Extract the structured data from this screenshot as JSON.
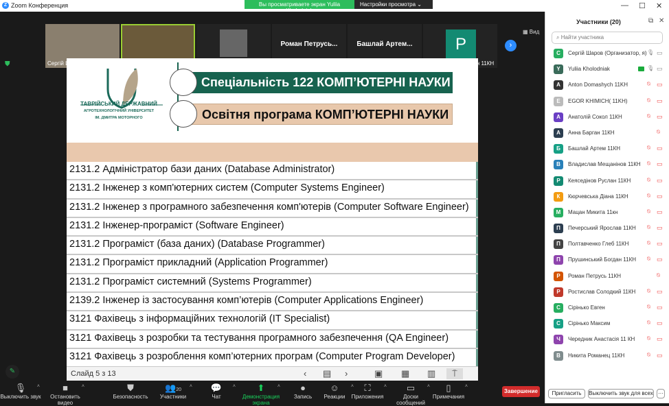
{
  "window": {
    "title": "Zoom Конференция",
    "banner": "Вы просматриваете экран Yuliia Kholodniak",
    "view_settings": "Настройки просмотра",
    "view_label": "Вид"
  },
  "videos": [
    {
      "name": "Сергій Шаров",
      "muted": false,
      "big": ""
    },
    {
      "name": "Yuliia Kholodniak",
      "muted": false,
      "big": ""
    },
    {
      "name": "Anton Domashych 11KH",
      "muted": true,
      "big": ""
    },
    {
      "name": "Роман Петрусь 11КН",
      "muted": true,
      "big": "Роман  Петрусь..."
    },
    {
      "name": "Башлай Артем 11КН",
      "muted": true,
      "big": "Башлай  Артем..."
    },
    {
      "name": "Кеяседінов Руслан 11КН",
      "muted": true,
      "big": "P"
    }
  ],
  "slide": {
    "university": [
      "ТАВРІЙСЬКИЙ ДЕРЖАВНИЙ",
      "АГРОТЕХНОЛОГІЧНИЙ УНІВЕРСИТЕТ",
      "ІМ. ДМИТРА МОТОРНОГО"
    ],
    "specialty": "Спеціальність 122 КОМП’ЮТЕРНІ НАУКИ",
    "program": "Освітня програма КОМП’ЮТЕРНІ НАУКИ",
    "rows": [
      "2131.2 Адміністратор бази даних (Database Administrator)",
      "2131.2 Інженер з комп'ютерних систем (Computer Systems Engineer)",
      "2131.2 Інженер з програмного забезпечення комп'ютерів (Computer Software Engineer)",
      "2131.2 Інженер-програміст (Software Engineer)",
      "2131.2 Програміст (база даних) (Database Programmer)",
      "2131.2 Програміст прикладний (Application Programmer)",
      "2131.2 Програміст системний (Systems Programmer)",
      "2139.2 Інженер із застосування комп’ютерів (Computer Applications Engineer)",
      "3121 Фахівець з інформаційних технологій (IT Specialist)",
      "3121 Фахівець з розробки та тестування програмного забезпечення (QA Engineer)",
      "3121 Фахівець з розроблення комп’ютерних програм (Computer Program Developer)"
    ],
    "counter": "Слайд 5 з 13"
  },
  "toolbar": {
    "items": [
      {
        "label": "Выключить звук",
        "icon": "microphone-icon"
      },
      {
        "label": "Остановить видео",
        "icon": "video-camera-icon"
      },
      {
        "label": "Безопасность",
        "icon": "shield-icon"
      },
      {
        "label": "Участники",
        "icon": "participants-icon",
        "badge": "20"
      },
      {
        "label": "Чат",
        "icon": "chat-icon"
      },
      {
        "label": "Демонстрация экрана",
        "icon": "share-screen-icon"
      },
      {
        "label": "Запись",
        "icon": "record-icon"
      },
      {
        "label": "Реакции",
        "icon": "reactions-icon"
      },
      {
        "label": "Приложения",
        "icon": "apps-icon"
      },
      {
        "label": "Доски сообщений",
        "icon": "whiteboard-icon"
      },
      {
        "label": "Примечания",
        "icon": "notes-icon"
      }
    ],
    "end": "Завершение"
  },
  "panel": {
    "title": "Участники (20)",
    "search_placeholder": "Найти участника",
    "invite": "Пригласить",
    "mute_all": "Выключить звук для всех",
    "more": "···",
    "participants": [
      {
        "name": "Сергій Шаров (Организатор, я)",
        "initial": "С",
        "color": "#27ae60",
        "mic": "on",
        "cam": "off-gray"
      },
      {
        "name": "Yuliia Kholodniak",
        "initial": "Y",
        "color": "#3a6b5a",
        "mic": "on",
        "cam": "off-gray",
        "sharing": true
      },
      {
        "name": "Anton Domashych 11KH",
        "initial": "A",
        "color": "#333333",
        "mic": "muted",
        "cam": "off"
      },
      {
        "name": "EGOR KHIMICH( 11KH)",
        "initial": "E",
        "color": "#bbbbbb",
        "mic": "muted",
        "cam": "off"
      },
      {
        "name": "Анатолій Сокол 11КН",
        "initial": "А",
        "color": "#6a3fc4",
        "mic": "muted",
        "cam": "off"
      },
      {
        "name": "Анна Барган 11КН",
        "initial": "А",
        "color": "#2c3e50",
        "mic": "muted",
        "cam": "none"
      },
      {
        "name": "Башлай Артем 11КН",
        "initial": "Б",
        "color": "#16a085",
        "mic": "muted",
        "cam": "off"
      },
      {
        "name": "Владислав Мещанінов 11КН",
        "initial": "В",
        "color": "#2980b9",
        "mic": "muted",
        "cam": "off"
      },
      {
        "name": "Кеяседінов Руслан 11КН",
        "initial": "Р",
        "color": "#138a72",
        "mic": "muted",
        "cam": "off"
      },
      {
        "name": "Кюрчевська Діана 11КН",
        "initial": "К",
        "color": "#f39c12",
        "mic": "muted",
        "cam": "off"
      },
      {
        "name": "Мацан Микита 11кн",
        "initial": "М",
        "color": "#27ae60",
        "mic": "muted",
        "cam": "off"
      },
      {
        "name": "Печерський Ярослав 11КН",
        "initial": "П",
        "color": "#2c3e50",
        "mic": "muted",
        "cam": "off"
      },
      {
        "name": "Полтавченко Глеб 11КН",
        "initial": "П",
        "color": "#444444",
        "mic": "muted",
        "cam": "off"
      },
      {
        "name": "Прушинський Богдан 11КН",
        "initial": "П",
        "color": "#8e44ad",
        "mic": "muted",
        "cam": "off"
      },
      {
        "name": "Роман Петрусь 11КН",
        "initial": "Р",
        "color": "#d35400",
        "mic": "muted",
        "cam": "none"
      },
      {
        "name": "Ростислав Солодкий 11КН",
        "initial": "Р",
        "color": "#c0392b",
        "mic": "muted",
        "cam": "off"
      },
      {
        "name": "Сірінько Евген",
        "initial": "С",
        "color": "#27ae60",
        "mic": "muted",
        "cam": "off"
      },
      {
        "name": "Сірінько Максим",
        "initial": "С",
        "color": "#16a085",
        "mic": "muted",
        "cam": "off"
      },
      {
        "name": "Чередник Анастасія 11 КН",
        "initial": "Ч",
        "color": "#8e44ad",
        "mic": "muted",
        "cam": "off"
      },
      {
        "name": "Никита Романец 11КН",
        "initial": "В",
        "color": "#7f8c8d",
        "mic": "muted",
        "cam": "off"
      }
    ]
  }
}
